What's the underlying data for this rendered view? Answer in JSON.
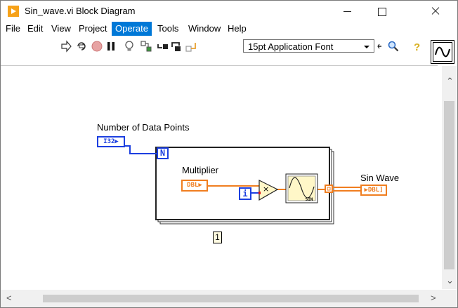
{
  "window": {
    "title": "Sin_wave.vi Block Diagram"
  },
  "menu": [
    "File",
    "Edit",
    "View",
    "Project",
    "Operate",
    "Tools",
    "Window",
    "Help"
  ],
  "menu_active": "Operate",
  "toolbar": {
    "font_select": "15pt Application Font"
  },
  "diagram": {
    "num_points_label": "Number of Data Points",
    "num_points_type": "I32",
    "count_terminal": "N",
    "iteration_terminal": "i",
    "multiplier_label": "Multiplier",
    "multiplier_type": "DBL",
    "sin_label": "SIN",
    "sin_wave_label": "Sin Wave",
    "sin_wave_type": "DBL",
    "loop_count_label": "1"
  },
  "colors": {
    "int_wire": "#1c3fe0",
    "dbl_wire": "#f07e20",
    "menu_highlight": "#0078d7"
  }
}
